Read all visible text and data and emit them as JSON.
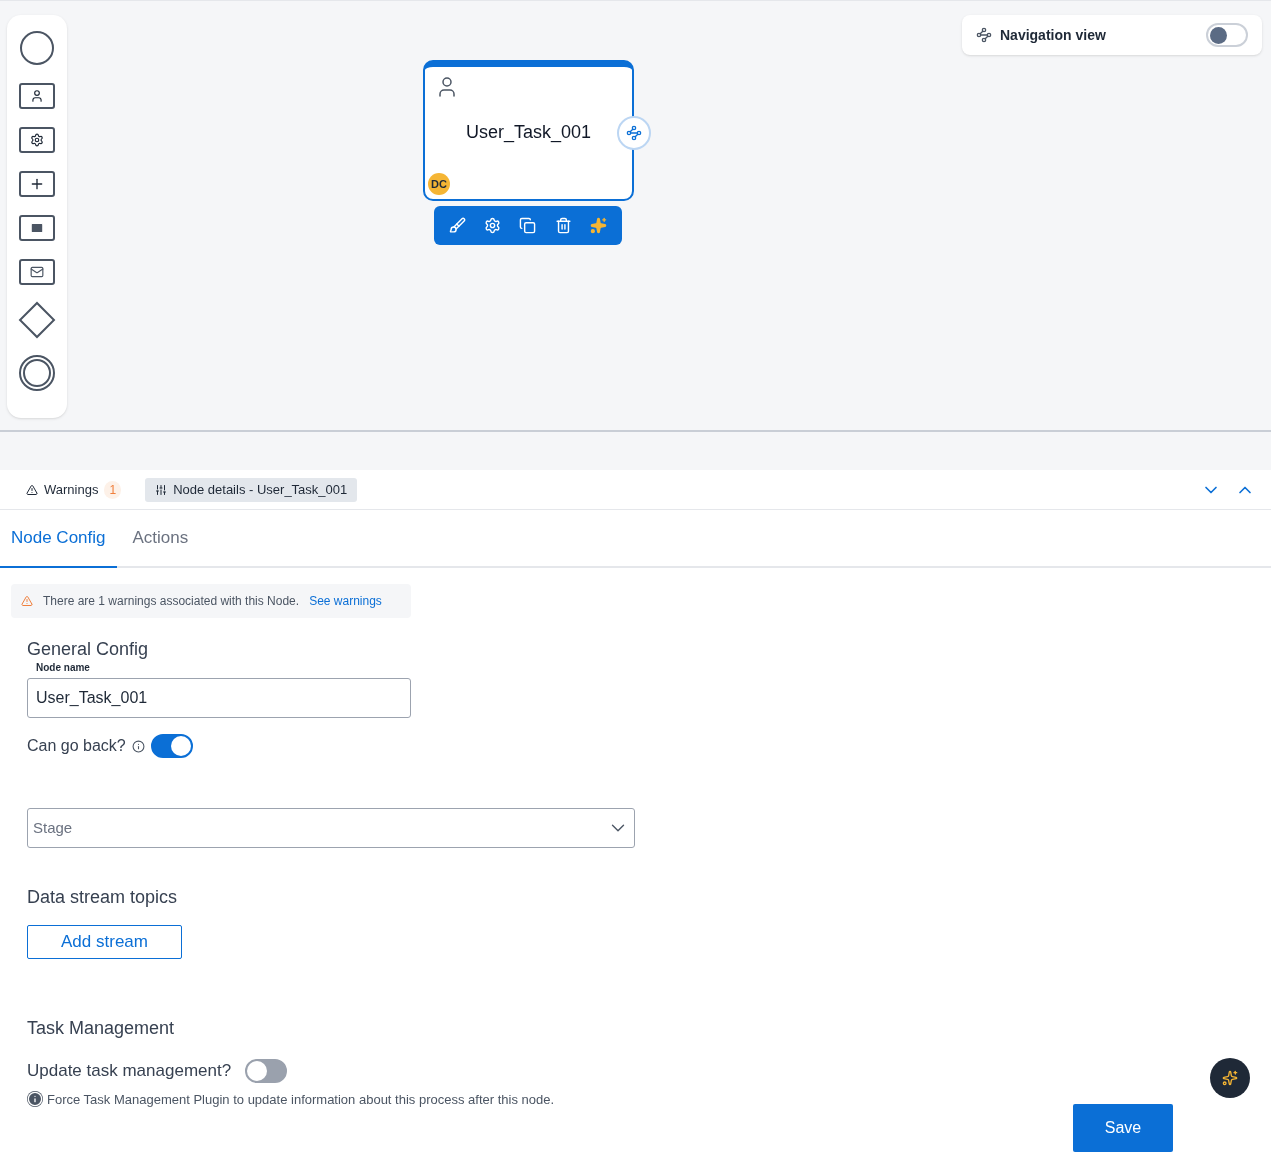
{
  "navigation_view": {
    "label": "Navigation view",
    "on": false
  },
  "node": {
    "title": "User_Task_001",
    "avatar": "DC",
    "selected": true
  },
  "panel_tabs": [
    {
      "kind": "warnings",
      "label": "Warnings",
      "count": "1",
      "selected": false
    },
    {
      "kind": "details",
      "label": "Node details - User_Task_001",
      "selected": true
    }
  ],
  "tabs": [
    {
      "label": "Node Config",
      "selected": true
    },
    {
      "label": "Actions",
      "selected": false
    }
  ],
  "alert": {
    "text": "There are 1 warnings associated with this Node.",
    "link": "See warnings"
  },
  "general_config": {
    "heading": "General Config",
    "node_name_label": "Node name",
    "node_name_value": "User_Task_001",
    "can_go_back": {
      "label": "Can go back?",
      "on": true
    }
  },
  "stage": {
    "placeholder": "Stage"
  },
  "data_stream": {
    "heading": "Data stream topics",
    "button": "Add stream"
  },
  "task_management": {
    "heading": "Task Management",
    "toggle": {
      "label": "Update task management?",
      "on": false
    },
    "info": "Force Task Management Plugin to update information about this process after this node."
  },
  "save": "Save"
}
